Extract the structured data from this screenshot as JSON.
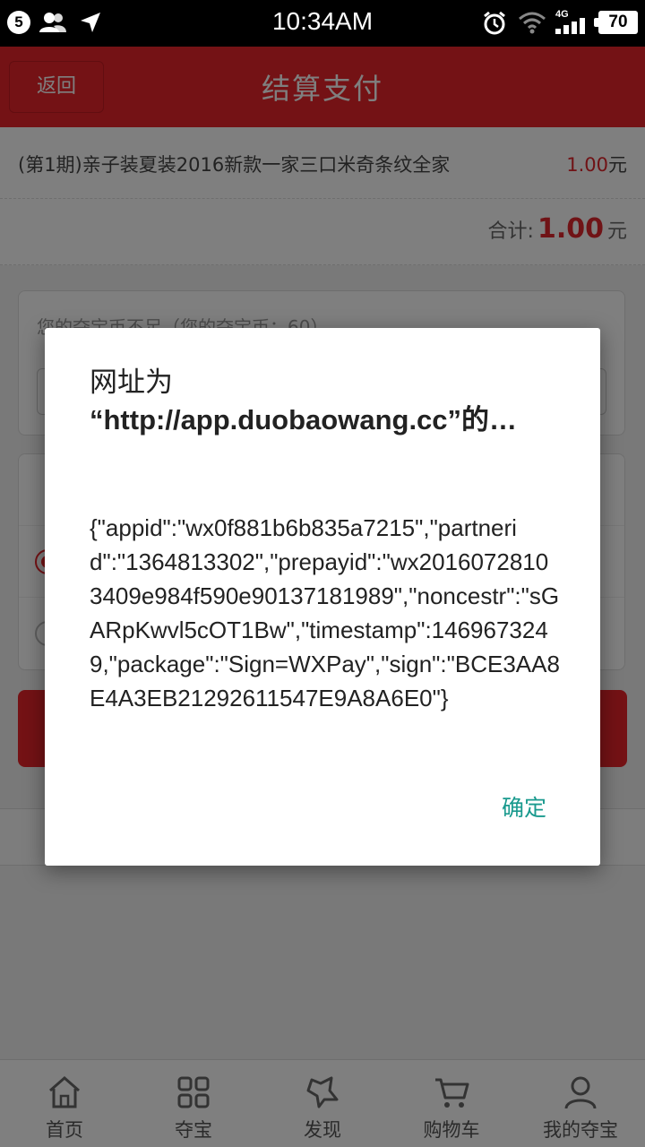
{
  "status_bar": {
    "notif_count": "5",
    "time": "10:34AM",
    "network": "4G",
    "battery": "70",
    "icons": [
      "users-icon",
      "location-arrow-icon",
      "alarm-icon",
      "wifi-icon",
      "signal-icon"
    ]
  },
  "header": {
    "back_label": "返回",
    "title": "结算支付",
    "color": "#e8242b"
  },
  "order": {
    "item_name": "(第1期)亲子装夏装2016新款一家三口米奇条纹全家",
    "item_price": "1.00",
    "item_unit": "元",
    "total_label": "合计:",
    "total_value": "1.00",
    "total_unit": "元"
  },
  "balance_notice": "您的夺宝币不足（您的夺宝币：60）",
  "dialog": {
    "title_line1": "网址为",
    "title_line2": "“http://app.duobaowang.cc”的…",
    "message": "{\"appid\":\"wx0f881b6b835a7215\",\"partnerid\":\"1364813302\",\"prepayid\":\"wx20160728103409e984f590e90137181989\",\"noncestr\":\"sGARpKwvl5cOT1Bw\",\"timestamp\":1469673249,\"package\":\"Sign=WXPay\",\"sign\":\"BCE3AA8E4A3EB21292611547E9A8A6E0\"}",
    "ok_label": "确定",
    "ok_color": "#1a9a8e"
  },
  "bottom_nav": [
    {
      "label": "首页",
      "icon": "home-icon"
    },
    {
      "label": "夺宝",
      "icon": "grid-icon"
    },
    {
      "label": "发现",
      "icon": "discover-icon"
    },
    {
      "label": "购物车",
      "icon": "cart-icon"
    },
    {
      "label": "我的夺宝",
      "icon": "user-icon"
    }
  ]
}
